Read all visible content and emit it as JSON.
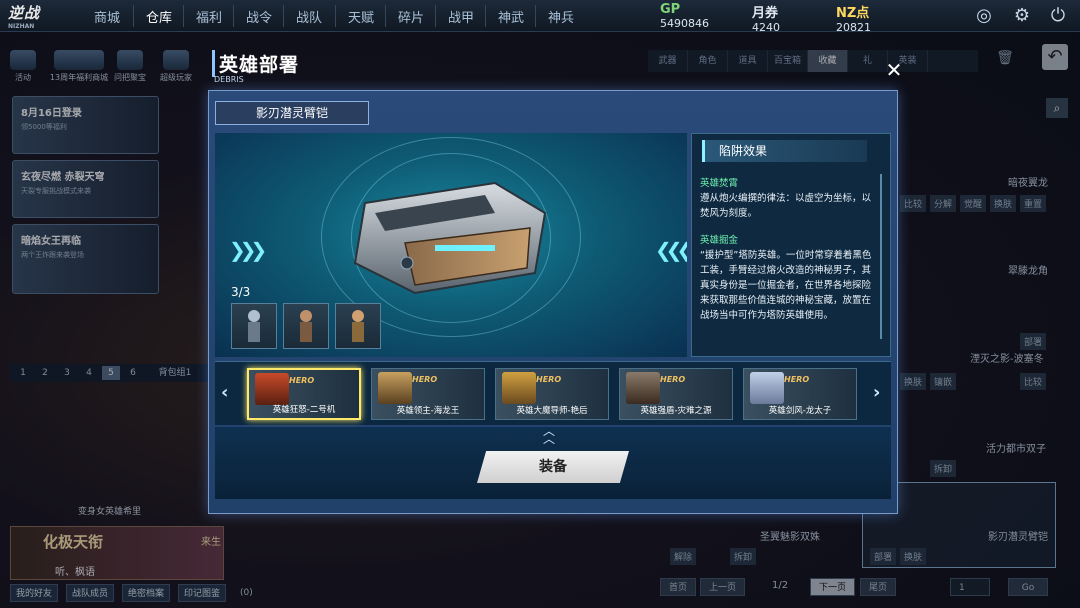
{
  "topnav": {
    "logo": "逆战",
    "logo_sub": "NIZHAN",
    "tabs": [
      "商城",
      "仓库",
      "福利",
      "战令",
      "战队",
      "天赋",
      "碎片",
      "战甲",
      "神武",
      "神兵"
    ],
    "active_tab": "仓库",
    "currencies": [
      {
        "label": "GP",
        "value": "5490846",
        "color": "#7fd37a"
      },
      {
        "label": "月券",
        "value": "4240",
        "color": "#dfe8f0"
      },
      {
        "label": "NZ点",
        "value": "20821",
        "color": "#ffd860"
      }
    ],
    "icons": [
      "target-icon",
      "settings-icon",
      "power-icon"
    ]
  },
  "sidebar": {
    "icon_labels": [
      "活动",
      "13周年福利商城",
      "问把聚宝",
      "超级玩家"
    ],
    "panels": [
      {
        "title": "8月16日登录",
        "sub": "领5000等福利"
      },
      {
        "title": "玄夜尽燃 赤裂天穹",
        "sub": "天裂专服挑战模式来袭"
      },
      {
        "title": "暗焰女王再临",
        "sub": "两个王炸跟来袭登场"
      }
    ],
    "pages": [
      "1",
      "2",
      "3",
      "4",
      "5",
      "6"
    ],
    "active_page": "5",
    "backpack": "背包组1",
    "hero_banner": "变身女英雄希里",
    "chat_name": "化极天衔",
    "chat_lines": [
      "来生",
      "听、枫语"
    ],
    "bottom_buttons": [
      "我的好友",
      "战队成员",
      "绝密档案",
      "印记图鉴"
    ],
    "mail_count": "(0)"
  },
  "inventory": {
    "tabs": [
      "武器",
      "角色",
      "道具",
      "百宝箱",
      "收藏",
      "礼",
      "英装"
    ],
    "active_tab": "收藏",
    "labels": [
      "暗夜翼龙",
      "翠滕龙角",
      "湮灭之影-波塞冬",
      "活力都市双子",
      "圣翼魅影双姝",
      "影刃潜灵臂铠"
    ],
    "actions": [
      "比较",
      "分解",
      "觉醒",
      "换肤",
      "重置",
      "部署",
      "换肤",
      "镶嵌",
      "比较",
      "拆卸",
      "解除",
      "拆卸",
      "部署",
      "换肤"
    ],
    "pager": {
      "first": "首页",
      "prev": "上一页",
      "page": "1/2",
      "next": "下一页",
      "last": "尾页",
      "goto": "1",
      "go": "Go"
    }
  },
  "modal": {
    "title": "英雄部署",
    "subtitle": "DEBRIS",
    "item_name": "影刃潜灵臂铠",
    "count": "3/3",
    "effect_title": "陷阱效果",
    "effects": [
      {
        "heading": "英雄焚霄",
        "text": "遵从炮火编撰的律法：以虚空为坐标，以焚风为刻度。"
      },
      {
        "heading": "英雄掘金",
        "text": "“援护型”塔防英雄。一位时常穿着着黑色工装，手臂经过熔火改造的神秘男子，其真实身份是一位掘金者，在世界各地探险来获取那些价值连城的神秘宝藏，放置在战场当中可作为塔防英雄使用。"
      }
    ],
    "hero_cards": [
      {
        "name": "英雄狂怒-二号机",
        "tag": "HERO",
        "selected": true
      },
      {
        "name": "英雄领主-海龙王",
        "tag": "HERO",
        "selected": false
      },
      {
        "name": "英雄大魔导师-艳后",
        "tag": "HERO",
        "selected": false
      },
      {
        "name": "英雄强盾-灾难之源",
        "tag": "HERO",
        "selected": false
      },
      {
        "name": "英雄剑风-龙太子",
        "tag": "HERO",
        "selected": false
      }
    ],
    "equip_button": "装备"
  }
}
